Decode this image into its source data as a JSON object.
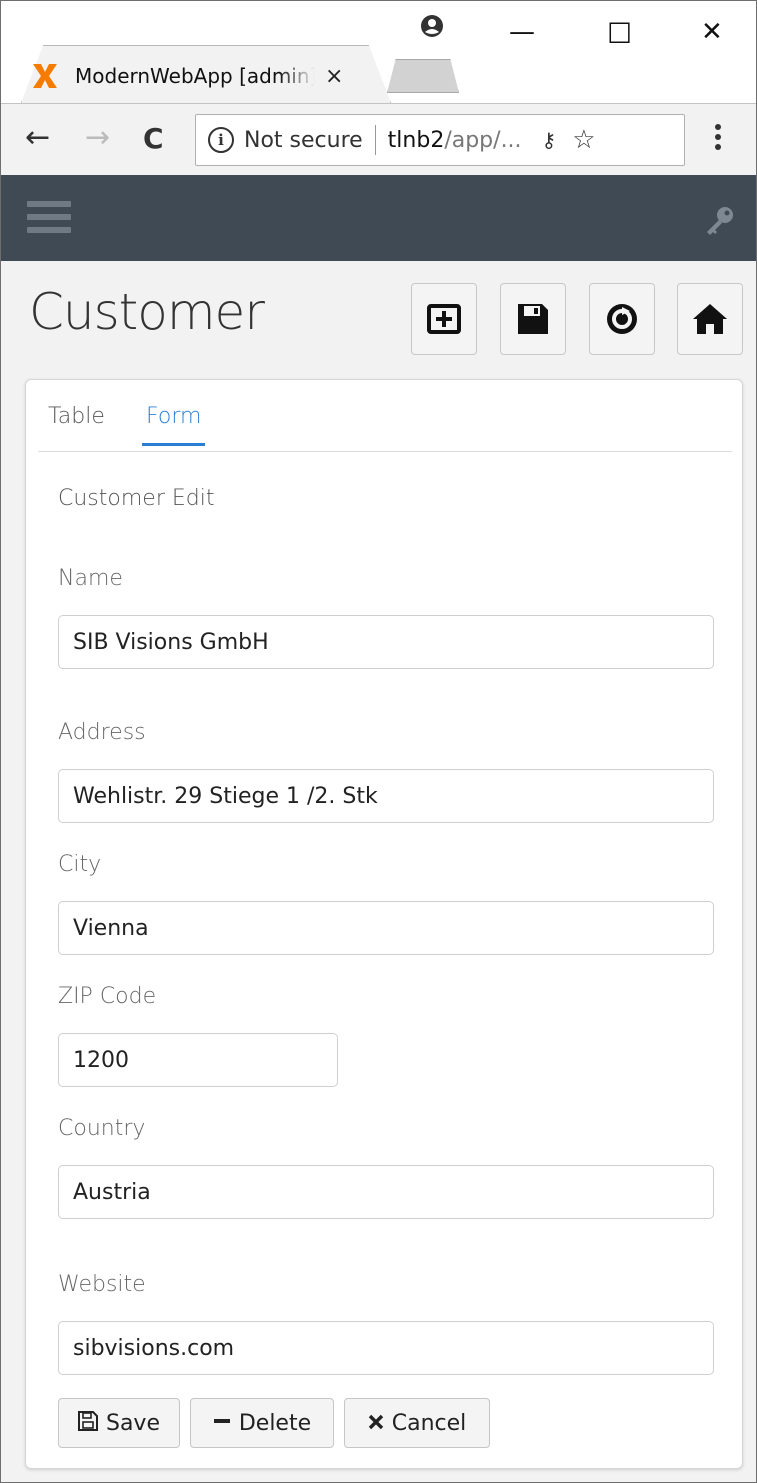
{
  "browser": {
    "tab_title": "ModernWebApp [admin]",
    "tab_close": "×",
    "win_minimize": "—",
    "win_maximize": "☐",
    "win_close": "✕",
    "back": "←",
    "forward": "→",
    "reload": "C",
    "security_text": "Not secure",
    "url_host": "tlnb2",
    "url_path": "/app/...",
    "key_glyph": "⚷",
    "star_glyph": "☆",
    "menu_glyph": "⋮"
  },
  "header": {
    "title": "Customer"
  },
  "tabs": [
    {
      "label": "Table",
      "active": false
    },
    {
      "label": "Form",
      "active": true
    }
  ],
  "form": {
    "section_title": "Customer Edit",
    "fields": [
      {
        "label": "Name",
        "value": "SIB Visions GmbH"
      },
      {
        "label": "Address",
        "value": "Wehlistr. 29 Stiege 1 /2. Stk"
      },
      {
        "label": "City",
        "value": "Vienna"
      },
      {
        "label": "ZIP Code",
        "value": "1200"
      },
      {
        "label": "Country",
        "value": "Austria"
      },
      {
        "label": "Website",
        "value": "sibvisions.com"
      }
    ]
  },
  "actions": {
    "save_label": "Save",
    "delete_label": "Delete",
    "cancel_label": "Cancel"
  },
  "colors": {
    "appbar": "#3f4a55",
    "accent": "#2a7fd4",
    "favicon": "#f57c00"
  }
}
